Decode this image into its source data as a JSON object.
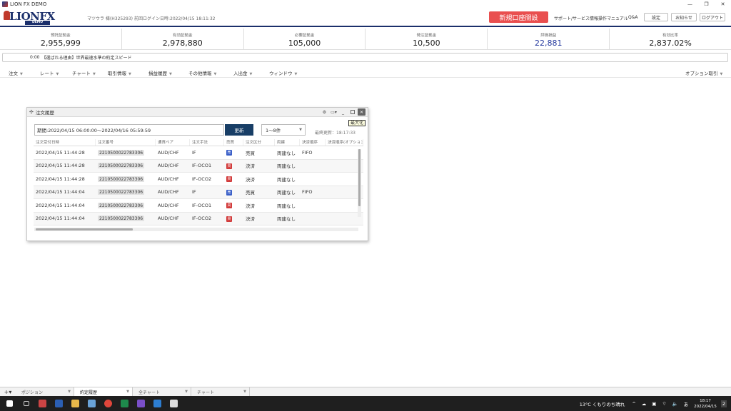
{
  "window": {
    "title": "LION FX DEMO",
    "controls": [
      "—",
      "❐",
      "✕"
    ]
  },
  "header": {
    "logo_main": "LIONFX",
    "logo_sub": "DEMO",
    "user": "マツウラ 様(H325293)",
    "last_login": "前回ログイン日時:2022/04/15 18:11:32",
    "new_account": "新規口座開設",
    "support": "サポート/サービス情報",
    "manual": "操作マニュアル",
    "qa": "Q&A",
    "settings": "設定",
    "notice": "お知らせ",
    "logout": "ログアウト"
  },
  "summary": [
    {
      "label": "預託証拠金",
      "value": "2,955,999"
    },
    {
      "label": "有効証拠金",
      "value": "2,978,880"
    },
    {
      "label": "必要証拠金",
      "value": "105,000"
    },
    {
      "label": "発注証拠金",
      "value": "10,500"
    },
    {
      "label": "評価損益",
      "value": "22,881"
    },
    {
      "label": "有効比率",
      "value": "2,837.02%"
    }
  ],
  "ticker": {
    "time": "0:00",
    "text": "【選ばれる理由】世界最速水準の約定スピード"
  },
  "menu": [
    "注文",
    "レート",
    "チャート",
    "取引情報",
    "損益履歴",
    "その他情報",
    "入出金",
    "ウィンドウ",
    "オプション取引"
  ],
  "panel": {
    "title": "注文履歴",
    "period": "期間:2022/04/15 06:00:00〜2022/04/16 05:59:59",
    "update": "更新",
    "count": "1〜8件",
    "last_updated": "最終更新：18:17:33",
    "tooltip": "最大化",
    "columns": [
      "注文受付日時",
      "注文番号",
      "通貨ペア",
      "注文手法",
      "売買",
      "注文区分",
      "両建",
      "決済順序",
      "決済順序(オプション"
    ],
    "rows": [
      {
        "datetime": "2022/04/15 11:44:28",
        "order_no": "2210500022783306",
        "pair": "AUD/CHF",
        "method": "IF",
        "side": "売",
        "type": "売買",
        "hedge": "両建なし",
        "settle": "FIFO"
      },
      {
        "datetime": "2022/04/15 11:44:28",
        "order_no": "2210500022783306",
        "pair": "AUD/CHF",
        "method": "IF-OCO1",
        "side": "買",
        "type": "決済",
        "hedge": "両建なし",
        "settle": ""
      },
      {
        "datetime": "2022/04/15 11:44:28",
        "order_no": "2210500022783306",
        "pair": "AUD/CHF",
        "method": "IF-OCO2",
        "side": "買",
        "type": "決済",
        "hedge": "両建なし",
        "settle": ""
      },
      {
        "datetime": "2022/04/15 11:44:04",
        "order_no": "2210500022783306",
        "pair": "AUD/CHF",
        "method": "IF",
        "side": "売",
        "type": "売買",
        "hedge": "両建なし",
        "settle": "FIFO"
      },
      {
        "datetime": "2022/04/15 11:44:04",
        "order_no": "2210500022783306",
        "pair": "AUD/CHF",
        "method": "IF-OCO1",
        "side": "買",
        "type": "決済",
        "hedge": "両建なし",
        "settle": ""
      },
      {
        "datetime": "2022/04/15 11:44:04",
        "order_no": "2210500022783306",
        "pair": "AUD/CHF",
        "method": "IF-OCO2",
        "side": "買",
        "type": "決済",
        "hedge": "両建なし",
        "settle": ""
      }
    ]
  },
  "tabs": [
    {
      "label": "ポジション",
      "active": false
    },
    {
      "label": "約定履歴",
      "active": true
    },
    {
      "label": "全チャート",
      "active": false
    },
    {
      "label": "チャート",
      "active": false
    }
  ],
  "taskbar": {
    "weather": "13°C くもりのち晴れ",
    "time": "18:17",
    "date": "2022/04/15",
    "notifications": "2"
  },
  "colors": {
    "brand": "#1b2f6b",
    "accent_red": "#e94f4f",
    "buy": "#3a5fc8",
    "sell": "#d23b3b",
    "update_btn": "#183e66"
  }
}
